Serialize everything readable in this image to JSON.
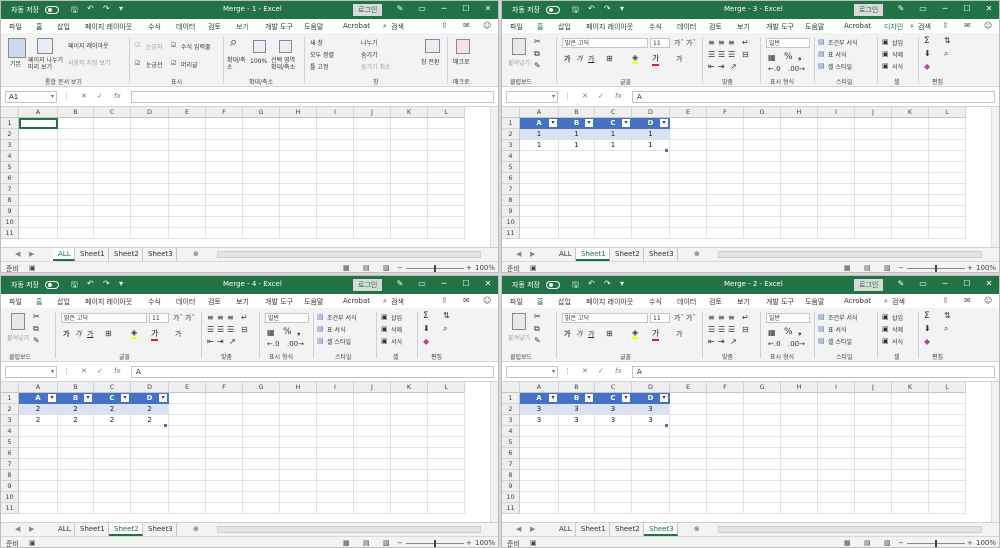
{
  "common": {
    "autosave": "자동 저장",
    "login": "로그인",
    "search": "검색",
    "tabs": [
      "파일",
      "홈",
      "삽입",
      "페이지 레이아웃",
      "수식",
      "데이터",
      "검토",
      "보기",
      "개발 도구",
      "도움말",
      "Acrobat"
    ],
    "design_tab": "디자인",
    "ready": "준비",
    "zoom": "100%",
    "sheets": [
      "ALL",
      "Sheet1",
      "Sheet2",
      "Sheet3"
    ],
    "fx": "fx",
    "columns": [
      "A",
      "B",
      "C",
      "D",
      "E",
      "F",
      "G",
      "H",
      "I",
      "J",
      "K",
      "L"
    ],
    "rows": [
      "1",
      "2",
      "3",
      "4",
      "5",
      "6",
      "7",
      "8",
      "9",
      "10",
      "11"
    ]
  },
  "view_ribbon": {
    "normal": "기본",
    "pagebreak": "페이지 나누기 미리 보기",
    "page_layout": "페이지 레이아웃",
    "custom_view": "사용자 지정 보기",
    "ruler": "눈금자",
    "formula_bar": "수식 입력줄",
    "gridlines": "눈금선",
    "headings": "머리글",
    "zoom": "확대/축소",
    "zoom100": "100%",
    "zoom_sel": "선택 영역 확대/축소",
    "new_window": "새 창",
    "arrange_all": "모두 정렬",
    "freeze": "틀 고정",
    "split": "나누기",
    "hide": "숨기기",
    "unhide": "숨기기 취소",
    "switch": "창 전환",
    "macro": "매크로",
    "g_views": "통합 문서 보기",
    "g_show": "표시",
    "g_zoom": "확대/축소",
    "g_window": "창",
    "g_macro": "매크로"
  },
  "home_ribbon": {
    "paste": "붙여넣기",
    "font": "맑은 고딕",
    "size": "11",
    "bold": "가",
    "italic": "가",
    "underline": "가",
    "number_fmt": "일반",
    "cond": "조건부 서식",
    "table_fmt": "표 서식",
    "cell_style": "셀 스타일",
    "insert": "삽입",
    "delete": "삭제",
    "format": "서식",
    "g_clip": "클립보드",
    "g_font": "글꼴",
    "g_align": "맞춤",
    "g_num": "표시 형식",
    "g_style": "스타일",
    "g_cell": "셀",
    "g_edit": "편집"
  },
  "windows": [
    {
      "title": "Merge - 1 - Excel",
      "active_tab": 7,
      "show_design": false,
      "namebox": "A1",
      "formula": "",
      "active_sheet": 0,
      "has_data": false,
      "values": []
    },
    {
      "title": "Merge - 3 - Excel",
      "active_tab": 1,
      "show_design": true,
      "namebox": "",
      "formula": "A",
      "active_sheet": 1,
      "has_data": true,
      "values": [
        "1",
        "1"
      ]
    },
    {
      "title": "Merge - 4 - Excel",
      "active_tab": 1,
      "show_design": false,
      "namebox": "",
      "formula": "A",
      "active_sheet": 2,
      "has_data": true,
      "values": [
        "2",
        "2"
      ]
    },
    {
      "title": "Merge - 2 - Excel",
      "active_tab": 1,
      "show_design": false,
      "namebox": "",
      "formula": "A",
      "active_sheet": 3,
      "has_data": true,
      "values": [
        "3",
        "3"
      ]
    }
  ],
  "header_labels": [
    "A",
    "B",
    "C",
    "D"
  ]
}
